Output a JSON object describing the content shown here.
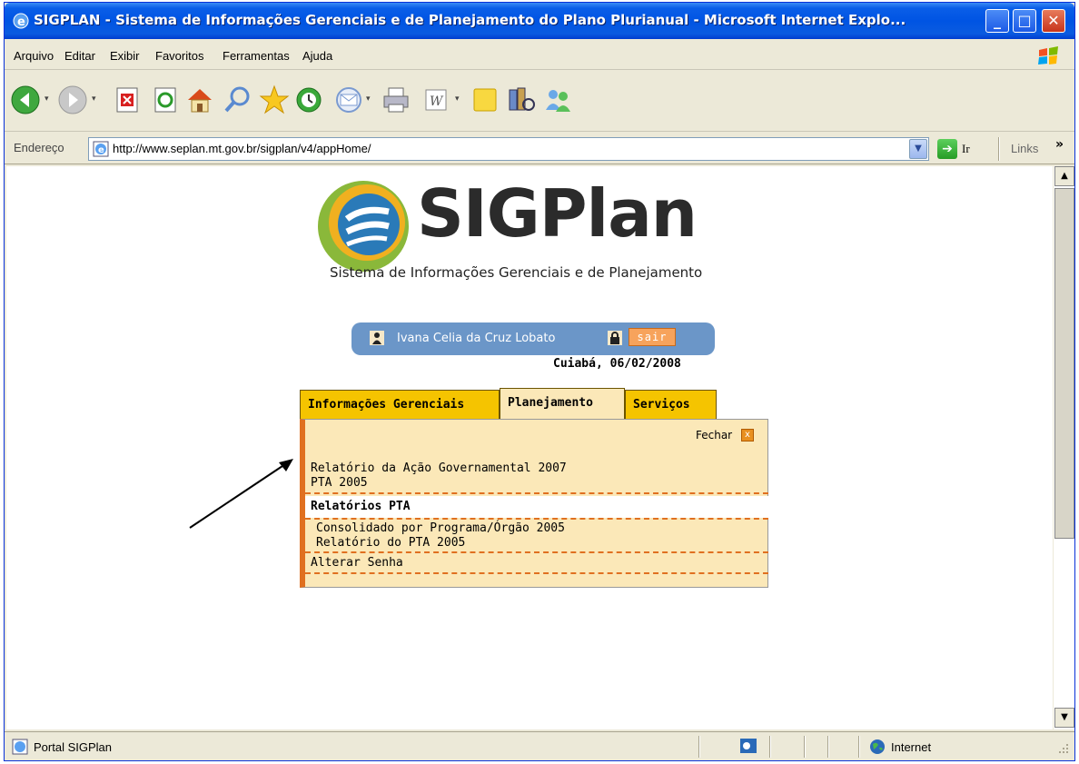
{
  "window": {
    "title": "SIGPLAN - Sistema de Informações Gerenciais e de Planejamento do Plano Plurianual - Microsoft Internet Explo...",
    "min_glyph": "_",
    "max_glyph": "□",
    "close_glyph": "✕"
  },
  "menu": {
    "items": [
      "Arquivo",
      "Editar",
      "Exibir",
      "Favoritos",
      "Ferramentas",
      "Ajuda"
    ]
  },
  "toolbar": {
    "icons": [
      "back-icon",
      "forward-icon",
      "stop-icon",
      "refresh-icon",
      "home-icon",
      "search-icon",
      "favorites-icon",
      "history-icon",
      "mail-icon",
      "print-icon",
      "edit-icon",
      "notes-icon",
      "research-icon",
      "messenger-icon"
    ]
  },
  "address": {
    "label": "Endereço",
    "url": "http://www.seplan.mt.gov.br/sigplan/v4/appHome/",
    "go_label": "Ir",
    "links_label": "Links",
    "links_chevron": "»",
    "dropdown_glyph": "▼"
  },
  "logo": {
    "name": "SIGPlan",
    "subtitle": "Sistema de Informações Gerenciais e de Planejamento"
  },
  "user": {
    "name": "Ivana Celia da Cruz Lobato",
    "logout_label": "sair",
    "location_date": "Cuiabá, 06/02/2008"
  },
  "tabs": [
    {
      "label": "Informações Gerenciais",
      "active": false
    },
    {
      "label": "Planejamento",
      "active": true
    },
    {
      "label": "Serviços",
      "active": false
    }
  ],
  "panel": {
    "close_label": "Fechar",
    "close_glyph": "x",
    "items": [
      "Relatório da Ação Governamental 2007",
      "PTA 2005"
    ],
    "section_title": "Relatórios PTA",
    "section_items": [
      "Consolidado por Programa/Órgão 2005",
      "Relatório do PTA 2005"
    ],
    "footer_item": "Alterar Senha"
  },
  "status": {
    "text": "Portal SIGPlan",
    "zone": "Internet"
  },
  "scrollbar": {
    "up_glyph": "▲",
    "down_glyph": "▼"
  }
}
